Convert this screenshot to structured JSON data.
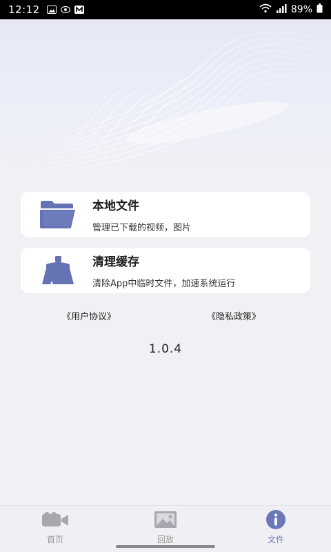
{
  "status_bar": {
    "time": "12:12",
    "battery": "89%",
    "left_icons": [
      "gallery-icon",
      "eye-icon",
      "m-app-icon"
    ],
    "right_icons": [
      "wifi-icon",
      "signal-icon",
      "battery-icon"
    ]
  },
  "menu": [
    {
      "title": "本地文件",
      "desc": "管理已下载的视频，图片",
      "icon": "folder-icon"
    },
    {
      "title": "清理缓存",
      "desc": "清除App中临时文件，加速系统运行",
      "icon": "broom-icon"
    }
  ],
  "links": {
    "user_agreement": "《用户协议》",
    "privacy_policy": "《隐私政策》"
  },
  "version": "1.0.4",
  "bottom_nav": [
    {
      "label": "首页",
      "icon": "video-camera-icon",
      "active": false
    },
    {
      "label": "回放",
      "icon": "image-icon",
      "active": false
    },
    {
      "label": "文件",
      "icon": "info-icon",
      "active": true
    }
  ],
  "colors": {
    "accent": "#6b77b8",
    "icon_fill": "#6572b4",
    "inactive_icon": "#a7a7af"
  }
}
